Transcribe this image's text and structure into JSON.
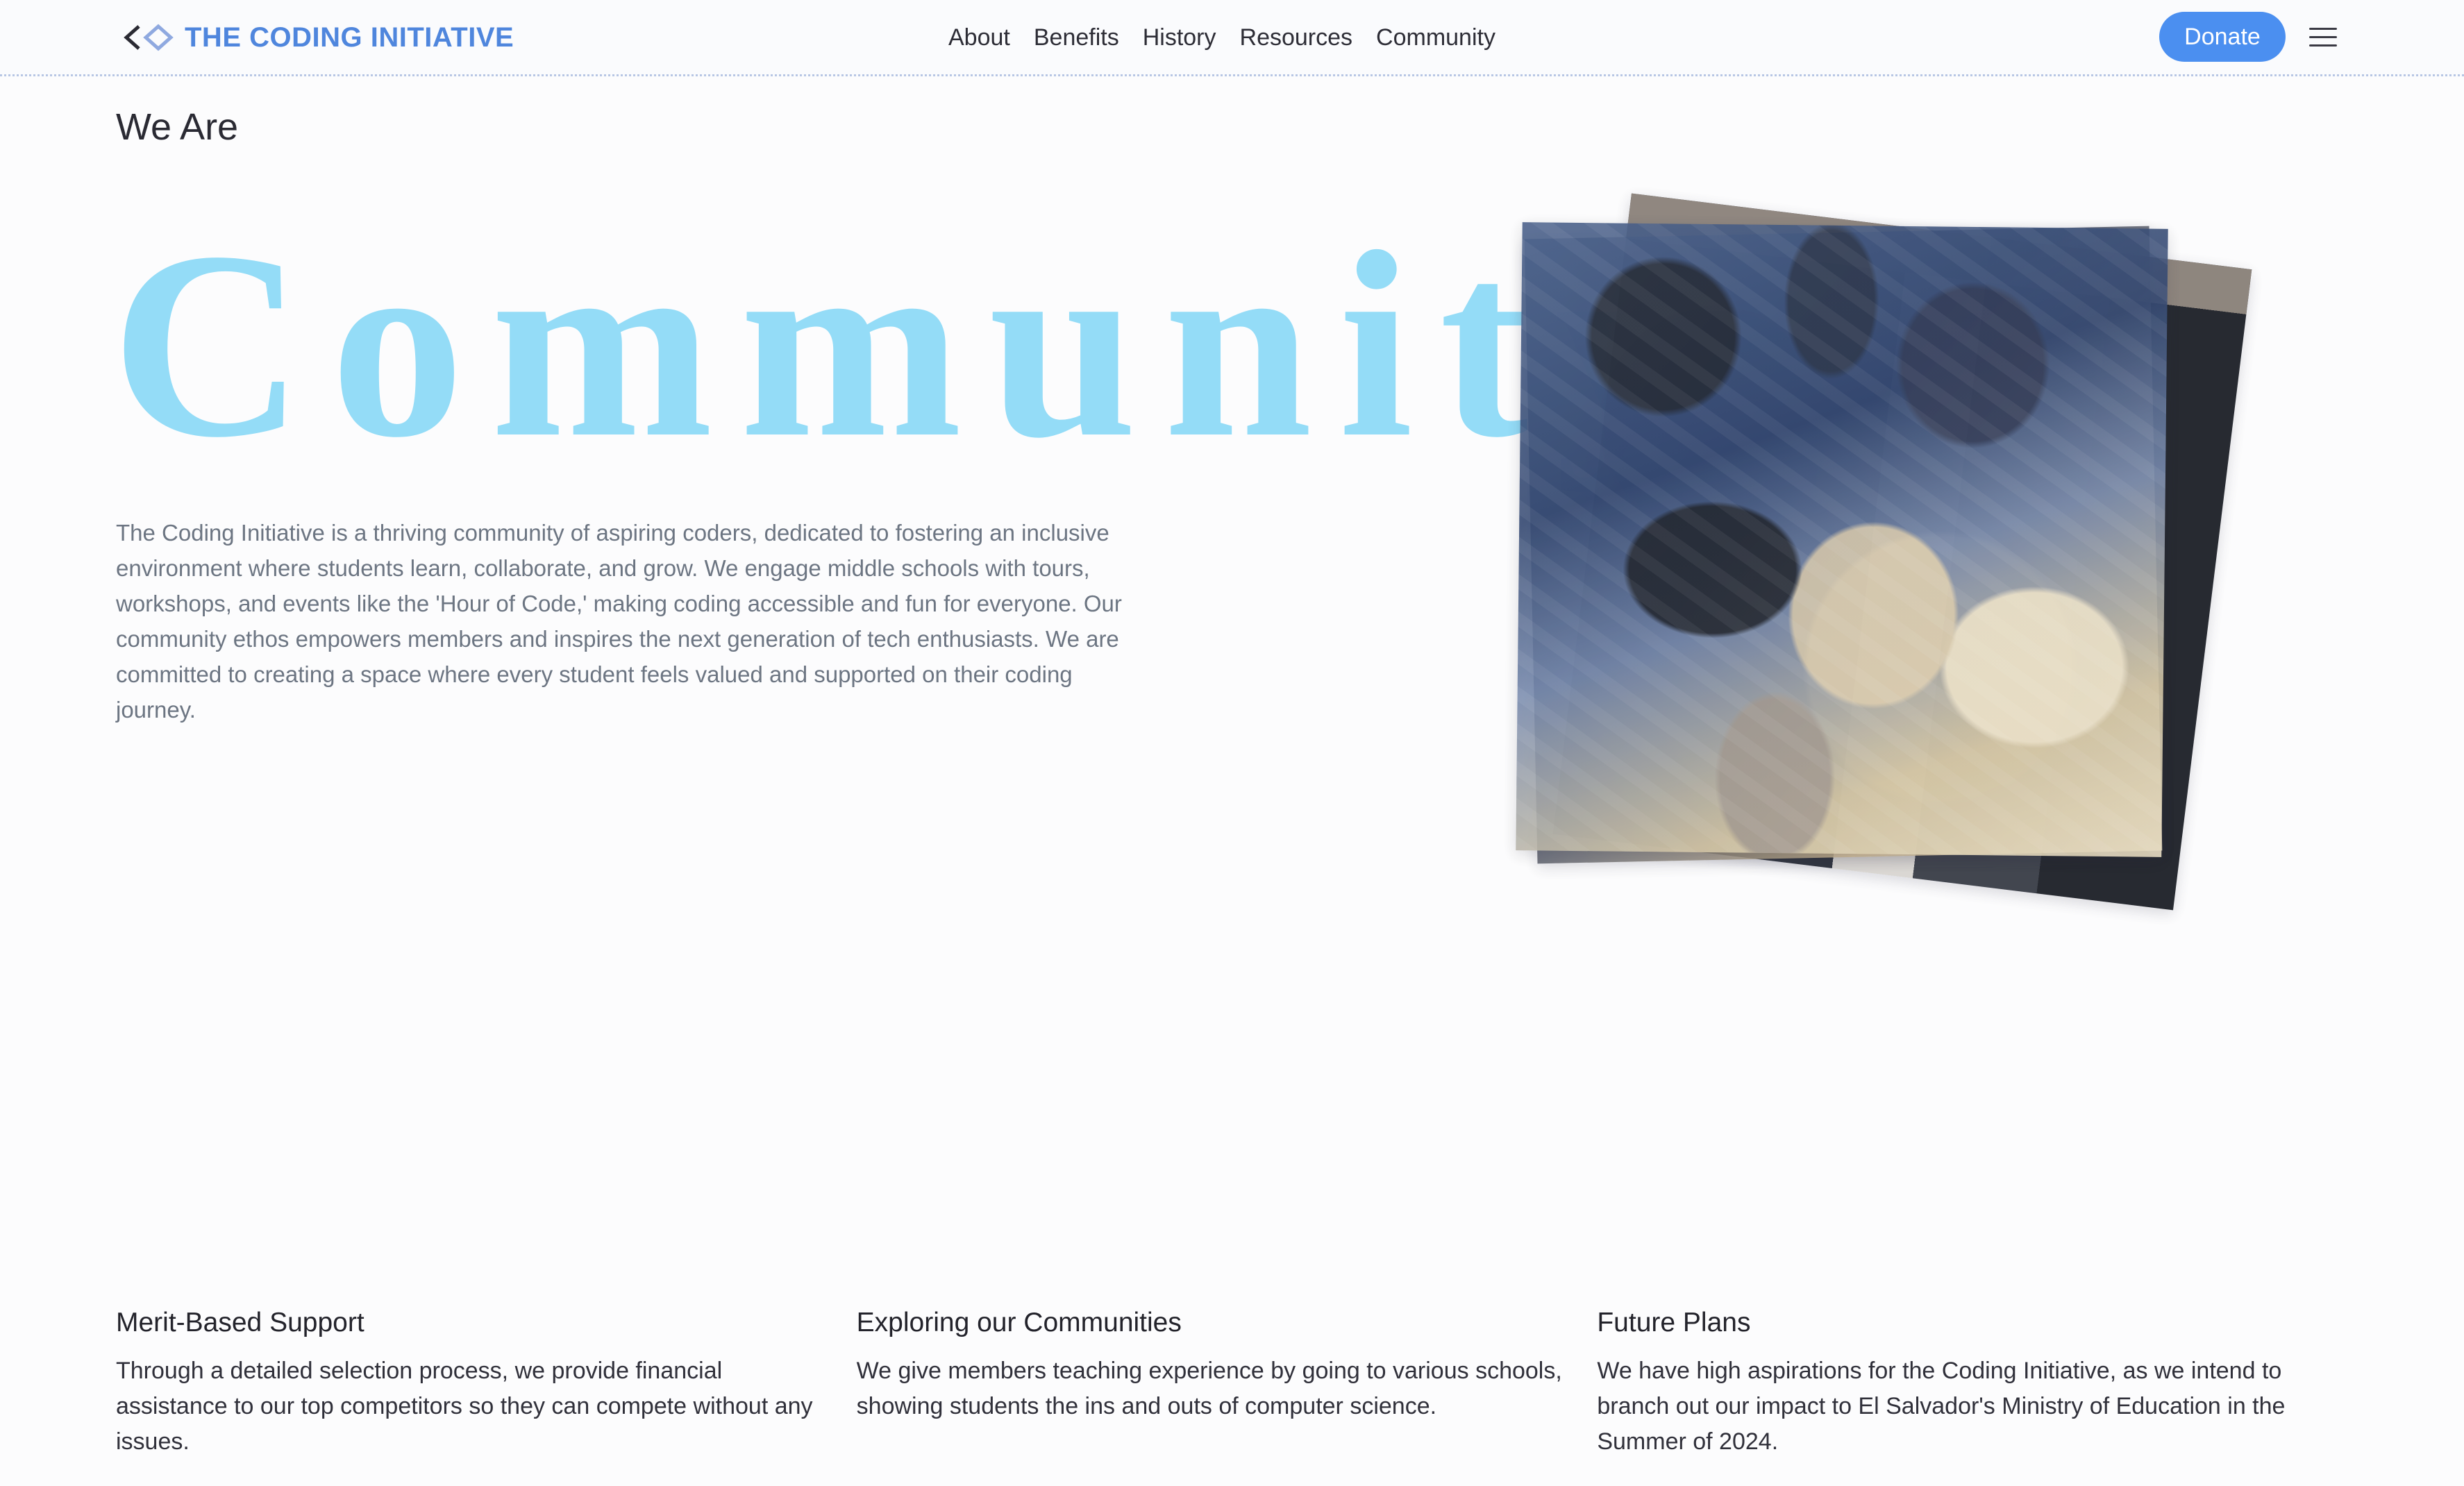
{
  "header": {
    "brand": {
      "logo_icon": "chevron-diamond-logo",
      "name": "THE CODING INITIATIVE"
    },
    "nav": [
      {
        "label": "About"
      },
      {
        "label": "Benefits"
      },
      {
        "label": "History"
      },
      {
        "label": "Resources"
      },
      {
        "label": "Community"
      }
    ],
    "donate_label": "Donate",
    "menu_icon": "hamburger-menu-icon"
  },
  "hero": {
    "eyebrow": "We Are",
    "headline": "Community",
    "description": "The Coding Initiative is a thriving community of aspiring coders, dedicated to fostering an inclusive environment where students learn, collaborate, and grow. We engage middle schools with tours, workshops, and events like the 'Hour of Code,' making coding accessible and fun for everyone. Our community ethos empowers members and inspires the next generation of tech enthusiasts. We are committed to creating a space where every student feels valued and supported on their coding journey."
  },
  "features": [
    {
      "title": "Merit-Based Support",
      "text": "Through a detailed selection process, we provide financial assistance to our top competitors so they can compete without any issues."
    },
    {
      "title": "Exploring our Communities",
      "text": "We give members teaching experience by going to various schools, showing students the ins and outs of computer science."
    },
    {
      "title": "Future Plans",
      "text": "We have high aspirations for the Coding Initiative, as we intend to branch out our impact to El Salvador's Ministry of Education in the Summer of 2024."
    }
  ],
  "colors": {
    "brand_blue": "#4f86dd",
    "donate_blue": "#4b8ff0",
    "hero_word": "#94dcf7",
    "body_text": "#6c7582"
  }
}
